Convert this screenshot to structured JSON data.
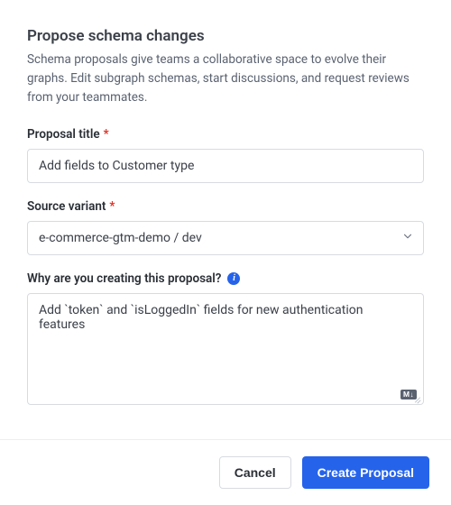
{
  "heading": "Propose schema changes",
  "description": "Schema proposals give teams a collaborative space to evolve their graphs. Edit subgraph schemas, start discussions, and request reviews from your teammates.",
  "fields": {
    "title": {
      "label": "Proposal title",
      "value": "Add fields to Customer type",
      "required": true
    },
    "source_variant": {
      "label": "Source variant",
      "value": "e-commerce-gtm-demo / dev",
      "required": true
    },
    "why": {
      "label": "Why are you creating this proposal?",
      "value": "Add `token` and `isLoggedIn` fields for new authentication features"
    }
  },
  "markdown_badge": "M↓",
  "info_icon_glyph": "i",
  "buttons": {
    "cancel": "Cancel",
    "create": "Create Proposal"
  }
}
